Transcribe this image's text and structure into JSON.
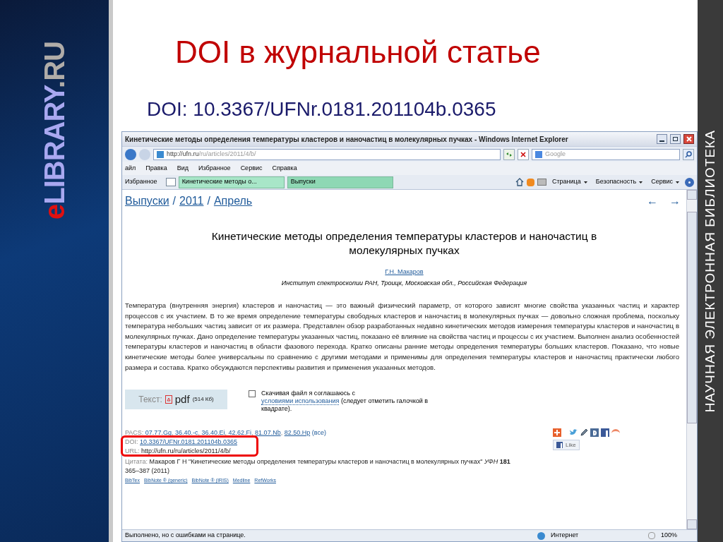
{
  "slide": {
    "title": "DOI в журнальной статье",
    "subtitle": "DOI: 10.3367/UFNr.0181.201104b.0365",
    "logo": [
      {
        "text": "e",
        "color": "#e01010"
      },
      {
        "text": "LIBRARY",
        "color": "#a9a8f0"
      },
      {
        "text": ".RU",
        "color": "#b0aca8"
      }
    ],
    "side_caption": "НАУЧНАЯ ЭЛЕКТРОННАЯ БИБЛИОТЕКА"
  },
  "browser": {
    "window_title": "Кинетические методы определения температуры кластеров и наночастиц в молекулярных пучках - Windows Internet Explorer",
    "address": {
      "host": "http://ufn.ru",
      "path": "/ru/articles/2011/4/b/"
    },
    "search_placeholder": "Google",
    "menu": [
      "айл",
      "Правка",
      "Вид",
      "Избранное",
      "Сервис",
      "Справка"
    ],
    "favorites": "Избранное",
    "tabs": [
      {
        "label": "Кинетические методы о...",
        "selected": true
      },
      {
        "label": "Выпуски",
        "selected": false
      }
    ],
    "commands": [
      "Страница",
      "Безопасность",
      "Сервис"
    ],
    "status": {
      "text": "Выполнено, но с ошибками на странице.",
      "zone": "Интернет",
      "zoom": "100%"
    }
  },
  "page": {
    "breadcrumbs": [
      {
        "kind": "link",
        "text": "Выпуски"
      },
      {
        "kind": "sep",
        "text": "/"
      },
      {
        "kind": "link",
        "text": "2011"
      },
      {
        "kind": "sep",
        "text": "/"
      },
      {
        "kind": "link",
        "text": "Апрель"
      }
    ],
    "nav": [
      "←",
      "→"
    ],
    "title": "Кинетические методы определения температуры кластеров и наночастиц в молекулярных пучках",
    "author": "Г.Н. Макаров",
    "affiliation": "Институт спектроскопии РАН, Троицк, Московская обл., Российская Федерация",
    "abstract": "Температура (внутренняя энергия) кластеров и наночастиц — это важный физический параметр, от которого зависят многие свойства указанных частиц и характер процессов с их участием. В то же время определение температуры свободных кластеров и наночастиц в молекулярных пучках — довольно сложная проблема, поскольку температура небольших частиц зависит от их размера. Представлен обзор разработанных недавно кинетических методов измерения температуры кластеров и наночастиц в молекулярных пучках. Дано определение температуры указанных частиц, показано её влияние на свойства частиц и процессы с их участием. Выполнен анализ особенностей температуры кластеров и наночастиц в области фазового перехода. Кратко описаны ранние методы определения температуры больших кластеров. Показано, что новые кинетические методы более универсальны по сравнению с другими методами и применимы для определения температуры кластеров и наночастиц практически любого размера и состава. Кратко обсуждаются перспективы развития и применения указанных методов.",
    "download": {
      "label": "Текст:",
      "format": "pdf",
      "size": "(514 Кб)"
    },
    "agreement": {
      "checked": false,
      "before": "Скачивая файл я соглашаюсь с",
      "link": "условиями использования",
      "after": "(следует отметить галочкой в квадрате)."
    },
    "pacs": {
      "label": "PACS:",
      "separator": ",",
      "codes": [
        "07.77.Gg",
        "36.40.-c",
        "36.40.Ei",
        "42.62.Fi",
        "81.07.Nb",
        "82.50.Hp"
      ],
      "all": "(все)"
    },
    "doi": {
      "label": "DOI:",
      "value": "10.3367/UFNr.0181.201104b.0365"
    },
    "url": {
      "label": "URL:",
      "value": "http://ufn.ru/ru/articles/2011/4/b/"
    },
    "citation": {
      "label": "Цитата:",
      "text": "Макаров Г Н \"Кинетические методы определения температуры кластеров и наночастиц в молекулярных пучках\" *УФН* **181** 365–387 (2011)"
    },
    "exports": [
      "BibTex",
      "BibNote ® (generic)",
      "BibNote ® (IRIS)",
      "Medline",
      "RefWorks"
    ],
    "like": "Like"
  }
}
